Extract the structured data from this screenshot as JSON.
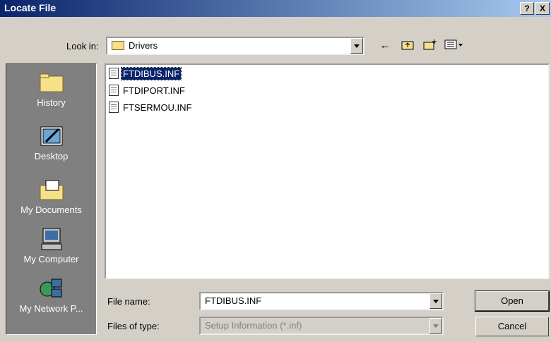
{
  "window": {
    "title": "Locate File",
    "help": "?",
    "close": "X"
  },
  "look_in": {
    "label": "Look in:",
    "value": "Drivers"
  },
  "toolbar": {
    "back": "←",
    "up": "up-folder",
    "new_folder": "new-folder",
    "view": "view-menu"
  },
  "places": [
    {
      "label": "History",
      "icon": "history-icon"
    },
    {
      "label": "Desktop",
      "icon": "desktop-icon"
    },
    {
      "label": "My Documents",
      "icon": "my-documents-icon"
    },
    {
      "label": "My Computer",
      "icon": "my-computer-icon"
    },
    {
      "label": "My Network P...",
      "icon": "network-places-icon"
    }
  ],
  "files": [
    {
      "name": "FTDIBUS.INF",
      "selected": true
    },
    {
      "name": "FTDIPORT.INF",
      "selected": false
    },
    {
      "name": "FTSERMOU.INF",
      "selected": false
    }
  ],
  "file_name": {
    "label": "File name:",
    "value": "FTDIBUS.INF"
  },
  "file_type": {
    "label": "Files of type:",
    "value": "Setup Information (*.inf)"
  },
  "buttons": {
    "open": "Open",
    "cancel": "Cancel"
  },
  "colors": {
    "titlebar_start": "#0a246a",
    "titlebar_end": "#a6caf0",
    "selection": "#0a246a",
    "places_bg": "#808080"
  }
}
